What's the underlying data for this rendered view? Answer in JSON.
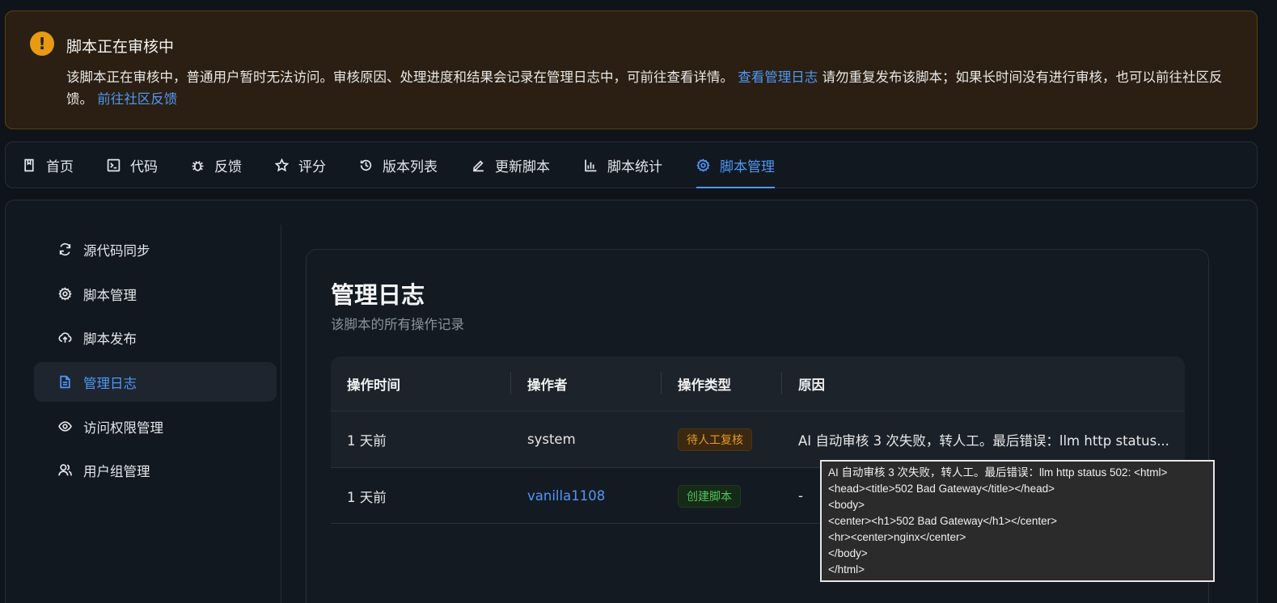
{
  "alert": {
    "icon": "exclamation-icon",
    "title": "脚本正在审核中",
    "body_text": "该脚本正在审核中，普通用户暂时无法访问。审核原因、处理进度和结果会记录在管理日志中，可前往查看详情。",
    "log_link": "查看管理日志",
    "body_text2": "请勿重复发布该脚本；如果长时间没有进行审核，也可以前",
    "body_text3": "往社区反馈。",
    "community_link": "前往社区反馈",
    "accent_color": "#e79a12"
  },
  "tabs": [
    {
      "label": "首页",
      "icon": "book-icon"
    },
    {
      "label": "代码",
      "icon": "terminal-icon"
    },
    {
      "label": "反馈",
      "icon": "bug-icon"
    },
    {
      "label": "评分",
      "icon": "star-icon"
    },
    {
      "label": "版本列表",
      "icon": "history-icon"
    },
    {
      "label": "更新脚本",
      "icon": "edit-icon"
    },
    {
      "label": "脚本统计",
      "icon": "bar-chart-icon"
    },
    {
      "label": "脚本管理",
      "icon": "gear-icon",
      "active": true
    }
  ],
  "sidebar": {
    "items": [
      {
        "label": "源代码同步",
        "icon": "sync-icon"
      },
      {
        "label": "脚本管理",
        "icon": "gear-icon"
      },
      {
        "label": "脚本发布",
        "icon": "cloud-upload-icon"
      },
      {
        "label": "管理日志",
        "icon": "file-text-icon",
        "active": true
      },
      {
        "label": "访问权限管理",
        "icon": "eye-icon"
      },
      {
        "label": "用户组管理",
        "icon": "user-group-icon"
      }
    ]
  },
  "log": {
    "title": "管理日志",
    "subtitle": "该脚本的所有操作记录",
    "columns": [
      "操作时间",
      "操作者",
      "操作类型",
      "原因"
    ],
    "rows": [
      {
        "time": "1 天前",
        "operator": "system",
        "type": "待人工复核",
        "reason": "AI 自动审核 3 次失败，转人工。最后错误：llm http status..."
      },
      {
        "time": "1 天前",
        "operator": "vanilla1108",
        "type": "创建脚本",
        "reason": "-"
      }
    ]
  },
  "tooltip": {
    "text": "AI 自动审核 3 次失败，转人工。最后错误：llm http status 502: <html>\n<head><title>502 Bad Gateway</title></head>\n<body>\n<center><h1>502 Bad Gateway</h1></center>\n<hr><center>nginx</center>\n</body>\n</html>"
  },
  "colors": {
    "link": "#4f97f5",
    "badge_orange": "#e69a1f",
    "badge_green": "#4fc25a"
  }
}
